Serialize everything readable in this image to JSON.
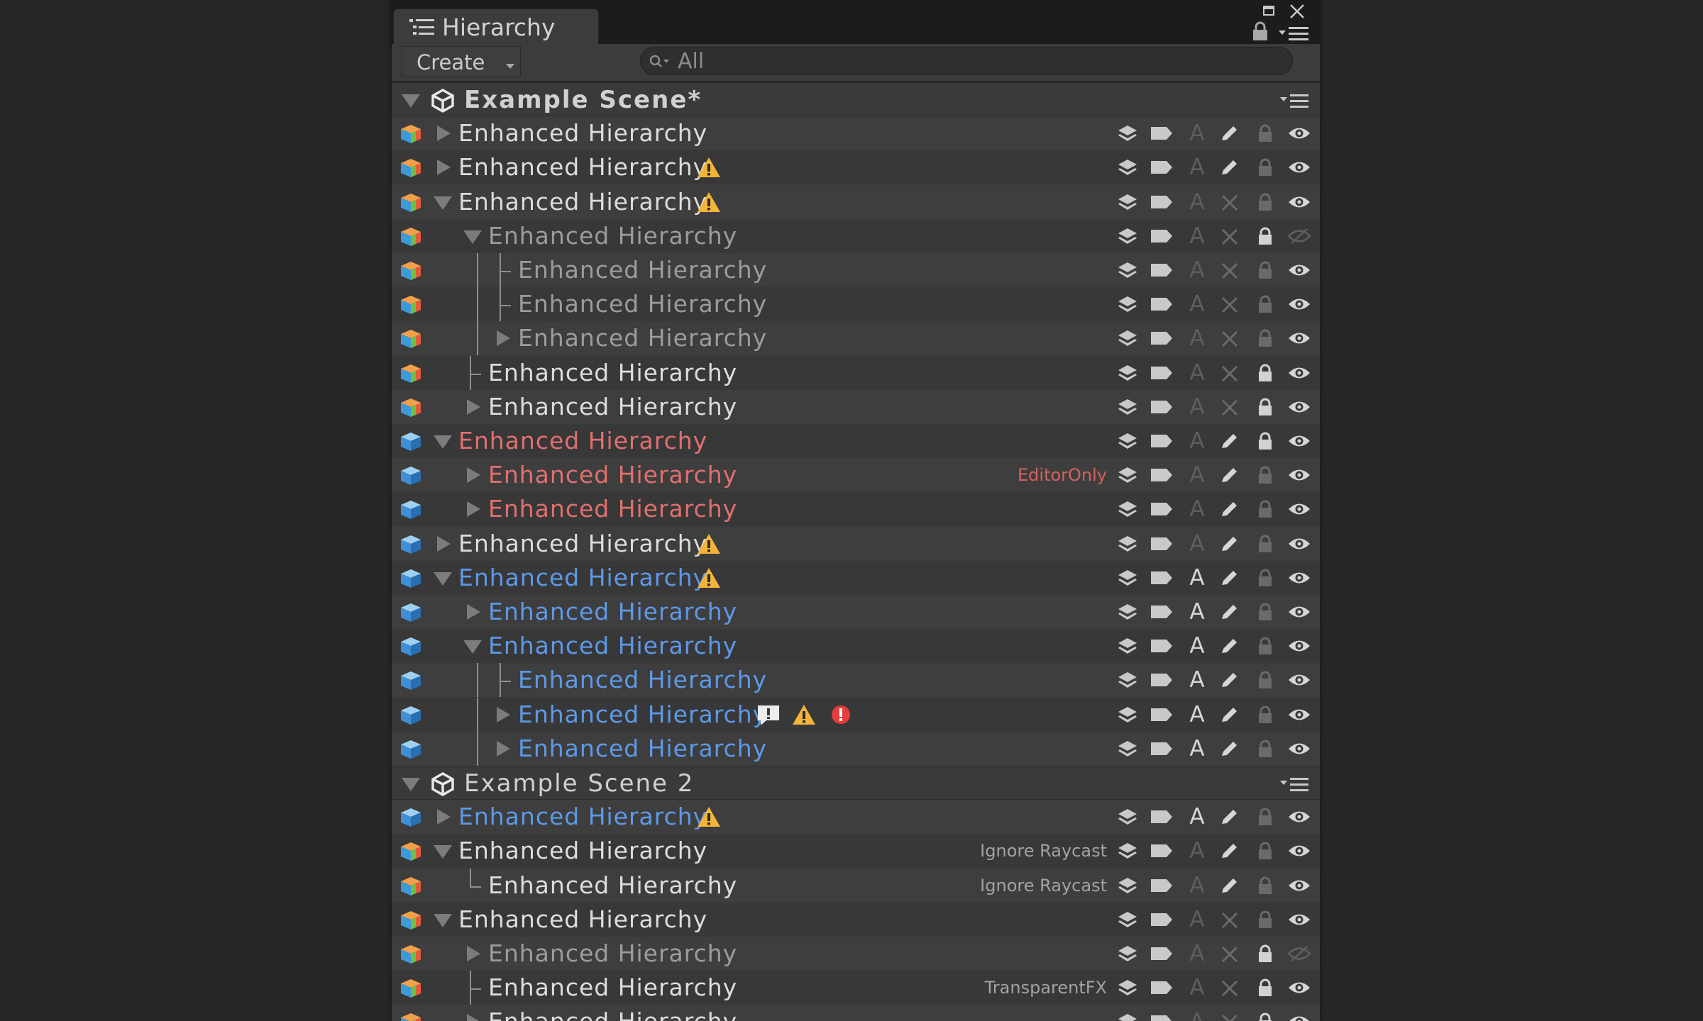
{
  "window": {
    "tab_label": "Hierarchy",
    "create_label": "Create",
    "search_placeholder": "All"
  },
  "colors": {
    "panel_bg": "#3c3c3c",
    "text_normal": "#dcdcdc",
    "text_dim": "#9c9c9c",
    "text_red": "#e0706e",
    "text_blue": "#5d99e8",
    "warning": "#f2b43a",
    "error": "#e53c3c"
  },
  "rows": [
    {
      "type": "scene",
      "label": "Example Scene*",
      "bold": true,
      "expanded": true
    },
    {
      "label": "Enhanced Hierarchy",
      "depth": 0,
      "fold": "right",
      "color": "normal",
      "cube": "orange",
      "icons": [
        "layer",
        "tag",
        "static-off",
        "edit",
        "lock-off",
        "eye"
      ]
    },
    {
      "label": "Enhanced Hierarchy",
      "depth": 0,
      "fold": "right",
      "color": "normal",
      "cube": "orange",
      "badges": [
        "warning-icon"
      ],
      "icons": [
        "layer",
        "tag",
        "static-off",
        "edit",
        "lock-off",
        "eye"
      ]
    },
    {
      "label": "Enhanced Hierarchy",
      "depth": 0,
      "fold": "down",
      "color": "normal",
      "cube": "orange",
      "badges": [
        "warning-icon"
      ],
      "icons": [
        "layer",
        "tag",
        "static-off",
        "noedit",
        "lock-off",
        "eye"
      ]
    },
    {
      "label": "Enhanced Hierarchy",
      "depth": 1,
      "fold": "down",
      "color": "dim",
      "cube": "orange",
      "icons": [
        "layer",
        "tag",
        "static-off",
        "noedit",
        "lock-on",
        "eye-off"
      ]
    },
    {
      "label": "Enhanced Hierarchy",
      "depth": 2,
      "fold": "leaf",
      "color": "dim",
      "cube": "orange",
      "icons": [
        "layer",
        "tag",
        "static-off",
        "noedit",
        "lock-off",
        "eye"
      ]
    },
    {
      "label": "Enhanced Hierarchy",
      "depth": 2,
      "fold": "leaf",
      "color": "dim",
      "cube": "orange",
      "icons": [
        "layer",
        "tag",
        "static-off",
        "noedit",
        "lock-off",
        "eye"
      ]
    },
    {
      "label": "Enhanced Hierarchy",
      "depth": 2,
      "fold": "right",
      "color": "dim",
      "cube": "orange",
      "icons": [
        "layer",
        "tag",
        "static-off",
        "noedit",
        "lock-off",
        "eye"
      ]
    },
    {
      "label": "Enhanced Hierarchy",
      "depth": 1,
      "fold": "leaf",
      "color": "normal",
      "cube": "orange",
      "icons": [
        "layer",
        "tag",
        "static-off",
        "noedit",
        "lock-on",
        "eye"
      ]
    },
    {
      "label": "Enhanced Hierarchy",
      "depth": 1,
      "fold": "right",
      "color": "normal",
      "cube": "orange",
      "icons": [
        "layer",
        "tag",
        "static-off",
        "noedit",
        "lock-on",
        "eye"
      ]
    },
    {
      "label": "Enhanced Hierarchy",
      "depth": 0,
      "fold": "down",
      "color": "red",
      "cube": "blue",
      "icons": [
        "layer",
        "tag",
        "static-off",
        "edit",
        "lock-on",
        "eye"
      ]
    },
    {
      "label": "Enhanced Hierarchy",
      "depth": 1,
      "fold": "right",
      "color": "red",
      "cube": "blue",
      "tag": "EditorOnly",
      "tag_red": true,
      "icons": [
        "layer",
        "tag",
        "static-off",
        "edit",
        "lock-off",
        "eye"
      ]
    },
    {
      "label": "Enhanced Hierarchy",
      "depth": 1,
      "fold": "right",
      "color": "red",
      "cube": "blue",
      "icons": [
        "layer",
        "tag",
        "static-off",
        "edit",
        "lock-off",
        "eye"
      ]
    },
    {
      "label": "Enhanced Hierarchy",
      "depth": 0,
      "fold": "right",
      "color": "normal",
      "cube": "blue",
      "badges": [
        "warning-icon"
      ],
      "icons": [
        "layer",
        "tag",
        "static-off",
        "edit",
        "lock-off",
        "eye"
      ]
    },
    {
      "label": "Enhanced Hierarchy",
      "depth": 0,
      "fold": "down",
      "color": "blue",
      "cube": "blue",
      "badges": [
        "warning-icon"
      ],
      "icons": [
        "layer",
        "tag",
        "static-on",
        "edit",
        "lock-off",
        "eye"
      ]
    },
    {
      "label": "Enhanced Hierarchy",
      "depth": 1,
      "fold": "right",
      "color": "blue",
      "cube": "blue",
      "icons": [
        "layer",
        "tag",
        "static-on",
        "edit",
        "lock-off",
        "eye"
      ]
    },
    {
      "label": "Enhanced Hierarchy",
      "depth": 1,
      "fold": "down",
      "color": "blue",
      "cube": "blue",
      "icons": [
        "layer",
        "tag",
        "static-on",
        "edit",
        "lock-off",
        "eye"
      ]
    },
    {
      "label": "Enhanced Hierarchy",
      "depth": 2,
      "fold": "leaf",
      "color": "blue",
      "cube": "blue",
      "icons": [
        "layer",
        "tag",
        "static-on",
        "edit",
        "lock-off",
        "eye"
      ]
    },
    {
      "label": "Enhanced Hierarchy",
      "depth": 2,
      "fold": "right",
      "color": "blue",
      "cube": "blue",
      "badges": [
        "comment-icon",
        "warning-icon",
        "error-icon"
      ],
      "icons": [
        "layer",
        "tag",
        "static-on",
        "edit",
        "lock-off",
        "eye"
      ]
    },
    {
      "label": "Enhanced Hierarchy",
      "depth": 2,
      "fold": "right",
      "color": "blue",
      "cube": "blue",
      "icons": [
        "layer",
        "tag",
        "static-on",
        "edit",
        "lock-off",
        "eye"
      ]
    },
    {
      "type": "scene",
      "label": "Example Scene 2",
      "bold": false,
      "expanded": true
    },
    {
      "label": "Enhanced Hierarchy",
      "depth": 0,
      "fold": "right",
      "color": "blue",
      "cube": "blue",
      "badges": [
        "warning-icon"
      ],
      "icons": [
        "layer",
        "tag",
        "static-on",
        "edit",
        "lock-off",
        "eye"
      ]
    },
    {
      "label": "Enhanced Hierarchy",
      "depth": 0,
      "fold": "down",
      "color": "normal",
      "cube": "orange",
      "tag": "Ignore Raycast",
      "icons": [
        "layer",
        "tag",
        "static-off",
        "edit",
        "lock-off",
        "eye"
      ]
    },
    {
      "label": "Enhanced Hierarchy",
      "depth": 1,
      "fold": "leaf-last",
      "color": "normal",
      "cube": "orange",
      "tag": "Ignore Raycast",
      "icons": [
        "layer",
        "tag",
        "static-off",
        "edit",
        "lock-off",
        "eye"
      ]
    },
    {
      "label": "Enhanced Hierarchy",
      "depth": 0,
      "fold": "down",
      "color": "normal",
      "cube": "orange",
      "icons": [
        "layer",
        "tag",
        "static-off",
        "noedit",
        "lock-off",
        "eye"
      ]
    },
    {
      "label": "Enhanced Hierarchy",
      "depth": 1,
      "fold": "right",
      "color": "dim",
      "cube": "orange",
      "icons": [
        "layer",
        "tag",
        "static-off",
        "noedit",
        "lock-on",
        "eye-off"
      ]
    },
    {
      "label": "Enhanced Hierarchy",
      "depth": 1,
      "fold": "leaf",
      "color": "normal",
      "cube": "orange",
      "tag": "TransparentFX",
      "icons": [
        "layer",
        "tag",
        "static-off",
        "noedit",
        "lock-on",
        "eye"
      ]
    },
    {
      "label": "Enhanced Hierarchy",
      "depth": 1,
      "fold": "right",
      "color": "normal",
      "cube": "orange",
      "icons": [
        "layer",
        "tag",
        "static-off",
        "noedit",
        "lock-on",
        "eye"
      ]
    }
  ]
}
